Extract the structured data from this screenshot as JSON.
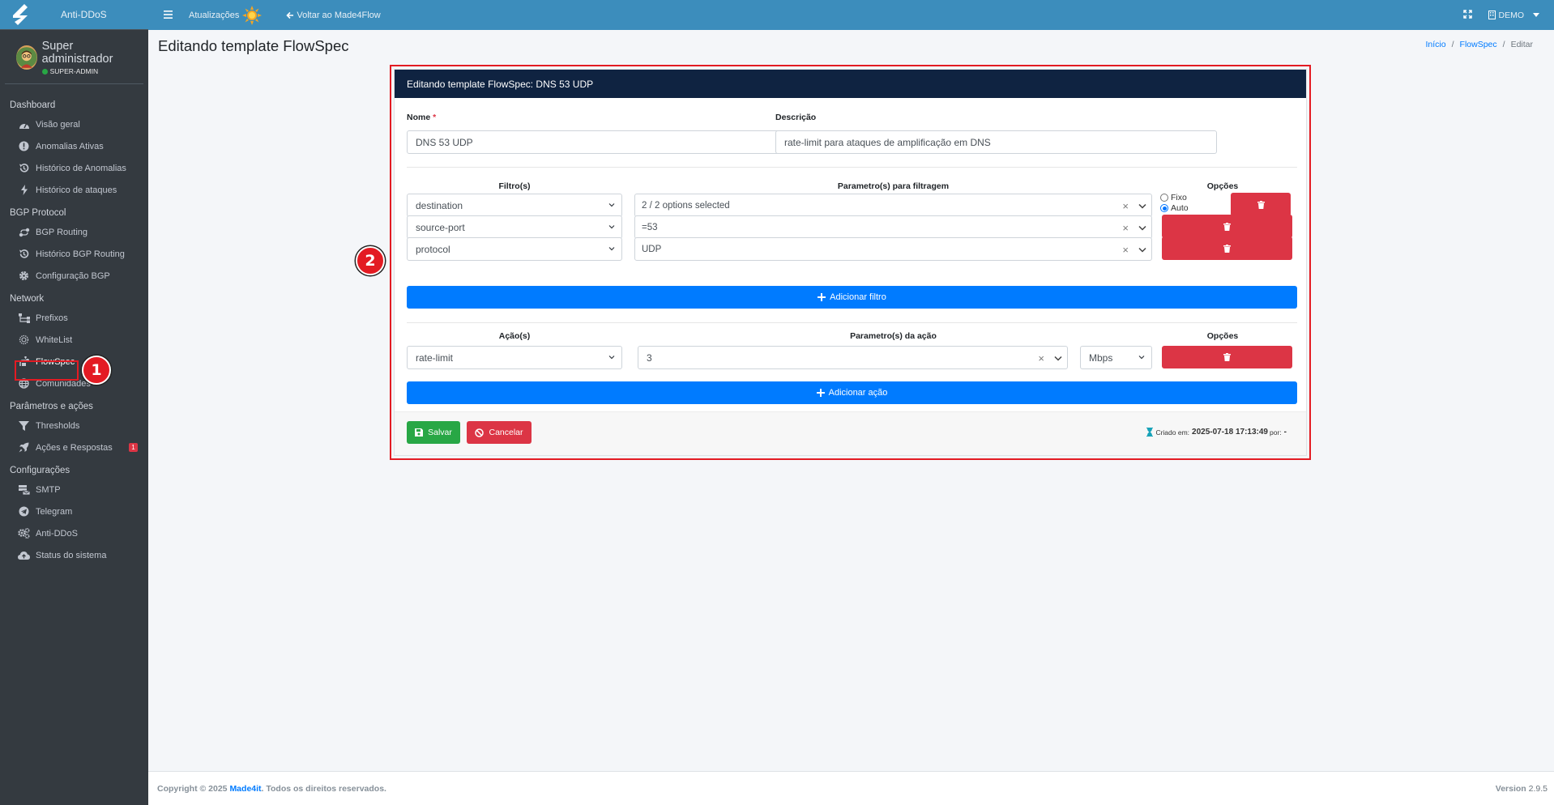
{
  "app": {
    "brand": "Anti-DDoS",
    "user_name": "Super administrador",
    "user_role": "SUPER-ADMIN"
  },
  "sidebar": {
    "sections": [
      {
        "header": "Dashboard",
        "items": [
          {
            "label": "Visão geral",
            "icon": "gauge-icon"
          },
          {
            "label": "Anomalias Ativas",
            "icon": "exclamation-circle-icon"
          },
          {
            "label": "Histórico de Anomalias",
            "icon": "history-icon"
          },
          {
            "label": "Histórico de ataques",
            "icon": "bolt-icon"
          }
        ]
      },
      {
        "header": "BGP Protocol",
        "items": [
          {
            "label": "BGP Routing",
            "icon": "route-icon"
          },
          {
            "label": "Histórico BGP Routing",
            "icon": "history-icon"
          },
          {
            "label": "Configuração BGP",
            "icon": "gear-icon"
          }
        ]
      },
      {
        "header": "Network",
        "items": [
          {
            "label": "Prefixos",
            "icon": "network-icon"
          },
          {
            "label": "WhiteList",
            "icon": "shield-icon"
          },
          {
            "label": "FlowSpec",
            "icon": "flowspec-icon"
          },
          {
            "label": "Comunidades",
            "icon": "globe-icon"
          }
        ]
      },
      {
        "header": "Parâmetros e ações",
        "items": [
          {
            "label": "Thresholds",
            "icon": "filter-icon"
          },
          {
            "label": "Ações e Respostas",
            "icon": "rocket-icon",
            "badge": "1"
          }
        ]
      },
      {
        "header": "Configurações",
        "items": [
          {
            "label": "SMTP",
            "icon": "mail-server-icon"
          },
          {
            "label": "Telegram",
            "icon": "telegram-icon"
          },
          {
            "label": "Anti-DDoS",
            "icon": "gears-icon"
          },
          {
            "label": "Status do sistema",
            "icon": "cloud-upload-icon"
          }
        ]
      }
    ]
  },
  "topbar": {
    "updates_label": "Atualizações",
    "back_label": "Voltar ao Made4Flow",
    "demo_label": "DEMO"
  },
  "page": {
    "title": "Editando template FlowSpec",
    "breadcrumb": [
      "Início",
      "FlowSpec",
      "Editar"
    ]
  },
  "card": {
    "header": "Editando template FlowSpec: DNS 53 UDP",
    "name_label": "Nome",
    "name_required": "*",
    "name_value": "DNS 53 UDP",
    "desc_label": "Descrição",
    "desc_value": "rate-limit para ataques de amplificação em DNS",
    "filters_col": "Filtro(s)",
    "params_col": "Parametro(s) para filtragem",
    "options_col": "Opções",
    "filters": [
      {
        "filter": "destination",
        "param": "2 / 2 options selected"
      },
      {
        "filter": "source-port",
        "param": "=53"
      },
      {
        "filter": "protocol",
        "param": "UDP"
      }
    ],
    "radio_fixo": "Fixo",
    "radio_auto": "Auto",
    "add_filter": "Adicionar filtro",
    "actions_col": "Ação(s)",
    "action_params_col": "Parametro(s) da ação",
    "action_options_col": "Opções",
    "action": {
      "type": "rate-limit",
      "value": "3",
      "unit": "Mbps"
    },
    "add_action": "Adicionar ação",
    "save": "Salvar",
    "cancel": "Cancelar",
    "created_label": "Criado em:",
    "created_at": "2025-07-18 17:13:49",
    "created_by_label": "por:",
    "created_by": "-"
  },
  "callouts": [
    "1",
    "2"
  ],
  "footer": {
    "copyright_prefix": "Copyright © 2025",
    "company": "Made4it",
    "rights": ". Todos os direitos reservados.",
    "version_label": "Version",
    "version": "2.9.5"
  },
  "colors": {
    "topbar": "#3c8dbc",
    "sidebar": "#343a40",
    "card_header": "#0f2341",
    "primary": "#007bff",
    "danger": "#dc3545",
    "success": "#28a745",
    "annotation": "#e31b23"
  }
}
